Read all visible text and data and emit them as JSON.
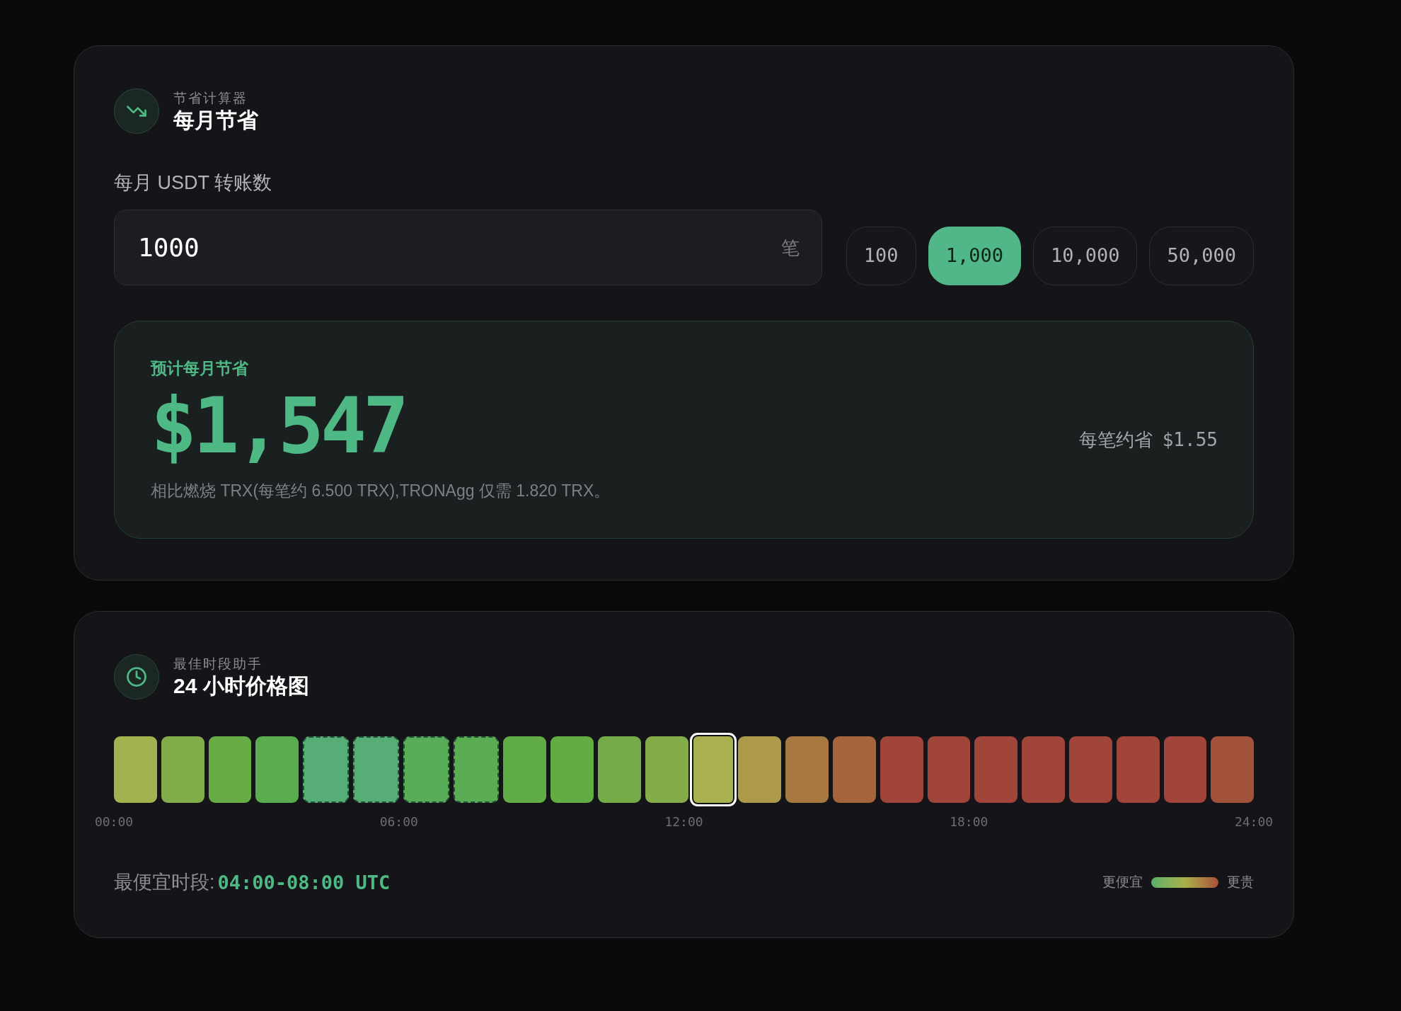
{
  "calculator": {
    "eyebrow": "节省计算器",
    "title": "每月节省",
    "field_label": "每月 USDT 转账数",
    "transfers_field": {
      "value": "1000",
      "unit": "笔"
    },
    "presets": [
      {
        "label": "100",
        "selected": false
      },
      {
        "label": "1,000",
        "selected": true
      },
      {
        "label": "10,000",
        "selected": false
      },
      {
        "label": "50,000",
        "selected": false
      }
    ],
    "result": {
      "label": "预计每月节省",
      "amount": "$1,547",
      "note": "相比燃烧 TRX(每笔约 6.500 TRX),TRONAgg 仅需 1.820 TRX。",
      "per_transfer_label": "每笔约省",
      "per_transfer_value": "$1.55"
    }
  },
  "price_chart": {
    "eyebrow": "最佳时段助手",
    "title": "24 小时价格图",
    "hours": [
      {
        "color": "#a3b24e",
        "selected": false,
        "cheapest": false
      },
      {
        "color": "#80ad4a",
        "selected": false,
        "cheapest": false
      },
      {
        "color": "#67ac45",
        "selected": false,
        "cheapest": false
      },
      {
        "color": "#5aad4e",
        "selected": false,
        "cheapest": false
      },
      {
        "color": "#57ad76",
        "selected": false,
        "cheapest": true
      },
      {
        "color": "#57ad76",
        "selected": false,
        "cheapest": true
      },
      {
        "color": "#5aad58",
        "selected": false,
        "cheapest": true
      },
      {
        "color": "#5aad52",
        "selected": false,
        "cheapest": true
      },
      {
        "color": "#61ad45",
        "selected": false,
        "cheapest": false
      },
      {
        "color": "#62ac43",
        "selected": false,
        "cheapest": false
      },
      {
        "color": "#75ac47",
        "selected": false,
        "cheapest": false
      },
      {
        "color": "#84ad4a",
        "selected": false,
        "cheapest": false
      },
      {
        "color": "#a9b04f",
        "selected": true,
        "cheapest": false
      },
      {
        "color": "#ad994a",
        "selected": false,
        "cheapest": false
      },
      {
        "color": "#a87a42",
        "selected": false,
        "cheapest": false
      },
      {
        "color": "#a6643c",
        "selected": false,
        "cheapest": false
      },
      {
        "color": "#a1453a",
        "selected": false,
        "cheapest": false
      },
      {
        "color": "#a1453a",
        "selected": false,
        "cheapest": false
      },
      {
        "color": "#a1453a",
        "selected": false,
        "cheapest": false
      },
      {
        "color": "#a1453a",
        "selected": false,
        "cheapest": false
      },
      {
        "color": "#a1453a",
        "selected": false,
        "cheapest": false
      },
      {
        "color": "#a1453a",
        "selected": false,
        "cheapest": false
      },
      {
        "color": "#a1453a",
        "selected": false,
        "cheapest": false
      },
      {
        "color": "#a2523a",
        "selected": false,
        "cheapest": false
      }
    ],
    "axis_labels": [
      "00:00",
      "06:00",
      "12:00",
      "18:00",
      "24:00"
    ],
    "best_window_label": "最便宜时段:",
    "best_window_value": "04:00-08:00 UTC",
    "legend": {
      "low_label": "更便宜",
      "high_label": "更贵"
    }
  }
}
